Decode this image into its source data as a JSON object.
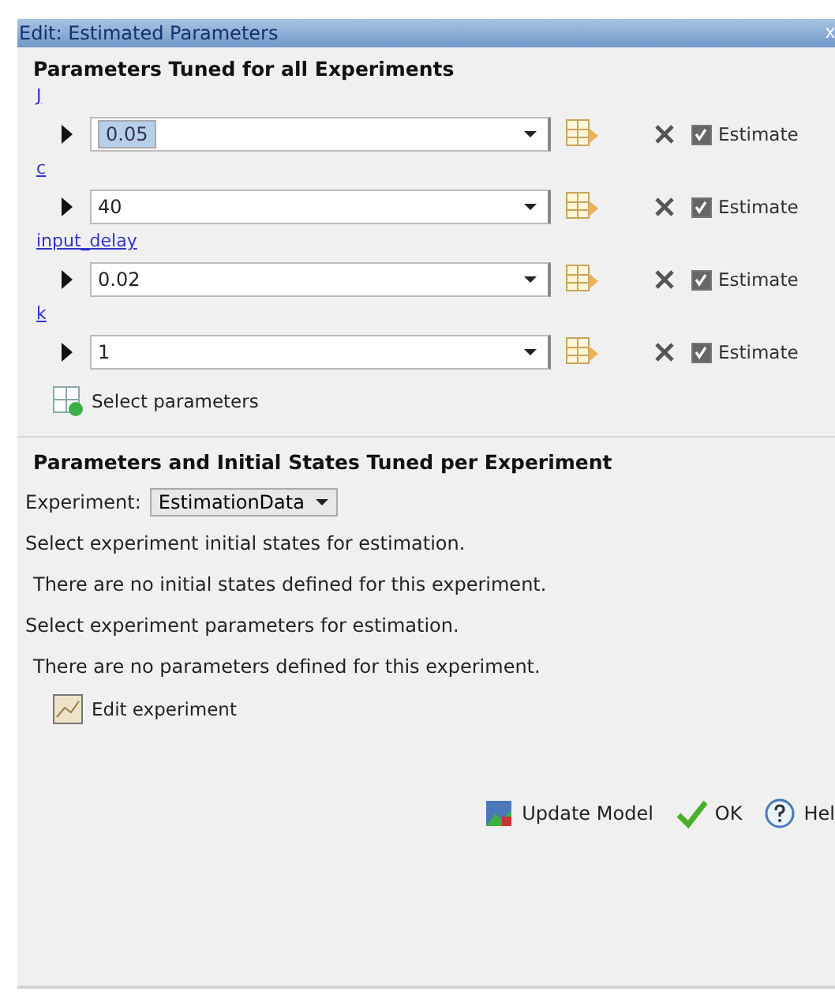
{
  "window": {
    "title": "Edit: Estimated Parameters",
    "close": "x"
  },
  "section_1": {
    "title": "Parameters Tuned for all Experiments",
    "parameters": [
      {
        "name": "J",
        "value": "0.05",
        "value_selected": true,
        "estimate_label": "Estimate",
        "checked": true
      },
      {
        "name": "c",
        "value": "40",
        "value_selected": false,
        "estimate_label": "Estimate",
        "checked": true
      },
      {
        "name": "input_delay",
        "value": "0.02",
        "value_selected": false,
        "estimate_label": "Estimate",
        "checked": true
      },
      {
        "name": "k",
        "value": "1",
        "value_selected": false,
        "estimate_label": "Estimate",
        "checked": true
      }
    ],
    "select_button": "Select parameters"
  },
  "section_2": {
    "title": "Parameters and Initial States Tuned per Experiment",
    "experiment_label": "Experiment:",
    "experiment_value": "EstimationData",
    "states_prompt": "Select experiment initial states for estimation.",
    "states_note": "There are no initial states defined for this experiment.",
    "params_prompt": "Select experiment parameters for estimation.",
    "params_note": "There are no parameters defined for this experiment.",
    "edit_button": "Edit experiment"
  },
  "buttons": [
    {
      "kind": "update",
      "label": "Update Model"
    },
    {
      "kind": "ok",
      "label": "OK"
    },
    {
      "kind": "help",
      "label": "Hel"
    }
  ]
}
